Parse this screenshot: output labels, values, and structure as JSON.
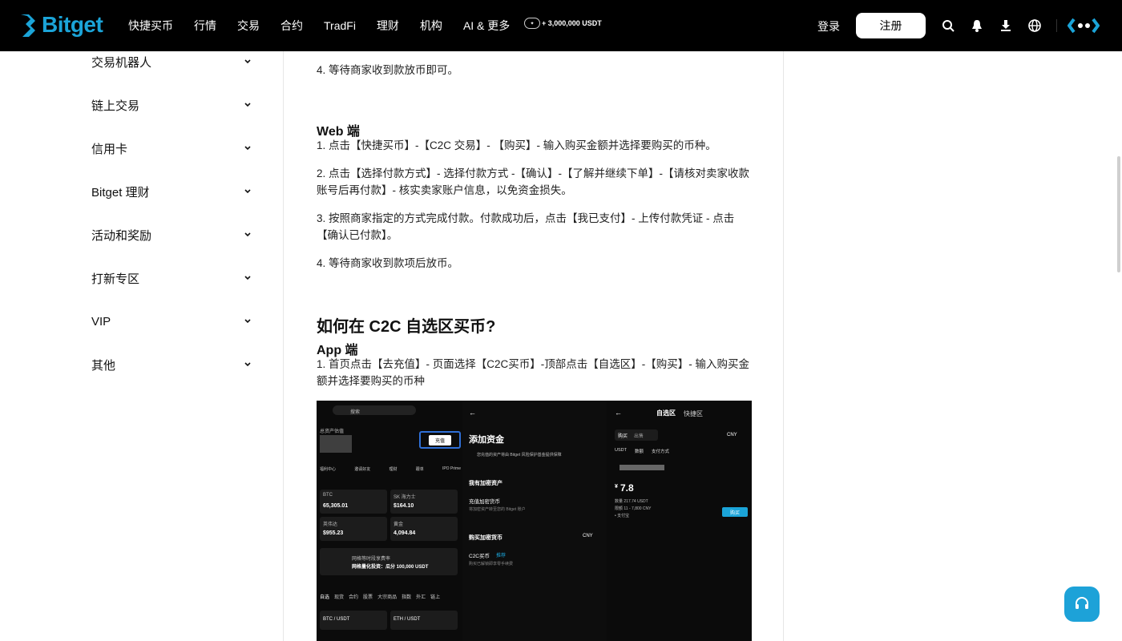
{
  "header": {
    "logo_text": "Bitget",
    "nav": [
      "快捷买币",
      "行情",
      "交易",
      "合约",
      "TradFi",
      "理财",
      "机构",
      "AI & 更多"
    ],
    "promo_text": "+ 3,000,000 USDT",
    "login_label": "登录",
    "register_label": "注册",
    "icons": [
      "search-icon",
      "bell-icon",
      "download-icon",
      "globe-icon",
      "brand-mark-icon"
    ],
    "accent": "#1ba4d8"
  },
  "sidebar": {
    "items": [
      {
        "label": "交易机器人"
      },
      {
        "label": "链上交易"
      },
      {
        "label": "信用卡"
      },
      {
        "label": "Bitget 理财"
      },
      {
        "label": "活动和奖励"
      },
      {
        "label": "打新专区"
      },
      {
        "label": "VIP"
      },
      {
        "label": "其他"
      }
    ]
  },
  "article": {
    "app_step4": "4. 等待商家收到款放币即可。",
    "web_heading": "Web 端",
    "web_steps": [
      "1. 点击【快捷买币】-【C2C 交易】- 【购买】- 输入购买金额并选择要购买的币种。",
      "2. 点击【选择付款方式】- 选择付款方式 -【确认】-【了解并继续下单】-【请核对卖家收款账号后再付款】- 核实卖家账户信息，以免资金损失。",
      "3. 按照商家指定的方式完成付款。付款成功后，点击【我已支付】- 上传付款凭证 - 点击【确认已付款】。",
      "4. 等待商家收到款项后放币。"
    ],
    "section_title": "如何在 C2C 自选区买币?",
    "app_heading": "App 端",
    "app_steps2": [
      "1. 首页点击【去充值】- 页面选择【C2C买币】-顶部点击【自选区】-【购买】- 输入购买金额并选择要购买的币种"
    ]
  },
  "screenshot": {
    "search_placeholder": "搜索",
    "total_assets_label": "总资产估值",
    "deposit_button": "充值",
    "quick_icons": [
      "福利中心",
      "邀请好友",
      "理财",
      "跟单",
      "IPO Prime"
    ],
    "tiles": [
      {
        "name": "BTC",
        "tag": "永续合约",
        "value": "65,305.01",
        "change": "+1.4%"
      },
      {
        "name": "SK 海力士",
        "tag": "永续",
        "value": "$164.10",
        "change": "+1.5%"
      },
      {
        "name": "英伟达",
        "tag": "美股",
        "value": "$955.23",
        "change": "+2.1%"
      },
      {
        "name": "黄金",
        "tag": "贵金属",
        "value": "4,094.84",
        "change": "+1.1%"
      }
    ],
    "banner_line1": "网格等时段享费率",
    "banner_line2": "网格量化投资：瓜分 100,000 USDT",
    "tabs": [
      "自选",
      "现货",
      "合约",
      "股票",
      "大宗商品",
      "指数",
      "外汇",
      "链上"
    ],
    "pairs": [
      "BTC / USDT",
      "ETH / USDT"
    ],
    "p2_title": "添加资金",
    "p2_notice": "您充值的资产将由 Bitget 风险保护基金提供保障",
    "p2_have_crypto": "我有加密资产",
    "p2_deposit": "充值加密货币",
    "p2_deposit_sub": "将加密资产转至您的 Bitget 账户",
    "p2_buy_crypto": "购买加密货币",
    "p2_currency": "CNY",
    "p2_c2c": "C2C买币",
    "p2_c2c_tag": "推荐",
    "p2_c2c_sub": "购买已解锁即享零手续费",
    "p3_tabs": [
      "自选区",
      "快捷区"
    ],
    "p3_buy": "购买",
    "p3_sell": "出售",
    "p3_currency": "CNY",
    "p3_filters": [
      "USDT",
      "数额",
      "支付方式"
    ],
    "p3_price_prefix": "¥",
    "p3_price": "7.8",
    "p3_qty": "数量 217.74 USDT",
    "p3_limit": "限额 11 - 7,800 CNY",
    "p3_pay": "• 支付宝",
    "p3_buy_button": "购买"
  }
}
